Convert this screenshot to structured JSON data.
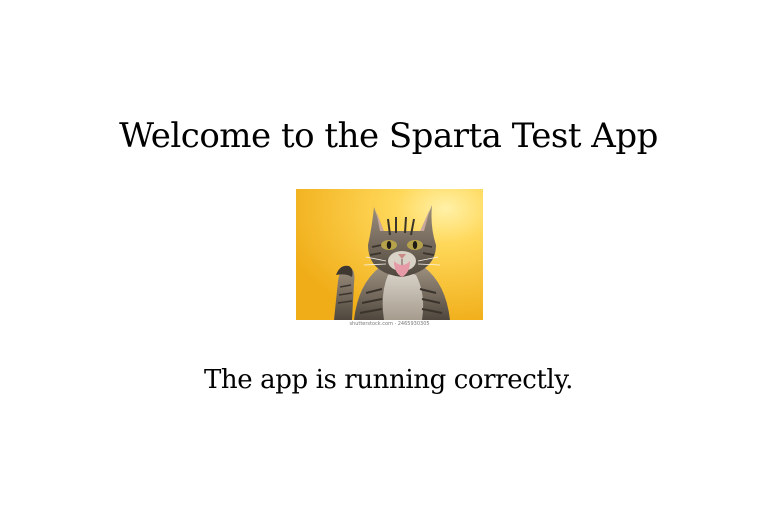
{
  "page": {
    "title": "Welcome to the Sparta Test App",
    "image": {
      "icon": "cat-photo",
      "watermark": "shutterstock.com · 2465930305",
      "colors": {
        "background": "#F2B51F",
        "highlight": "#FFE066"
      }
    },
    "status_message": "The app is running correctly."
  }
}
